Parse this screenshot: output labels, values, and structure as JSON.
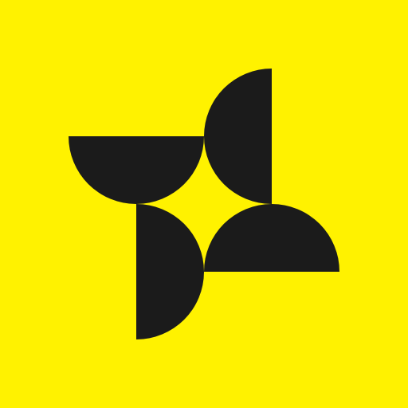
{
  "colors": {
    "background": "#FFF200",
    "mark": "#1B1B1B"
  },
  "logo": {
    "icon": "pinwheel-logo-icon",
    "parts": [
      "half-disc-top-left",
      "half-disc-top-right",
      "half-disc-bottom-left",
      "half-disc-bottom-right"
    ]
  }
}
